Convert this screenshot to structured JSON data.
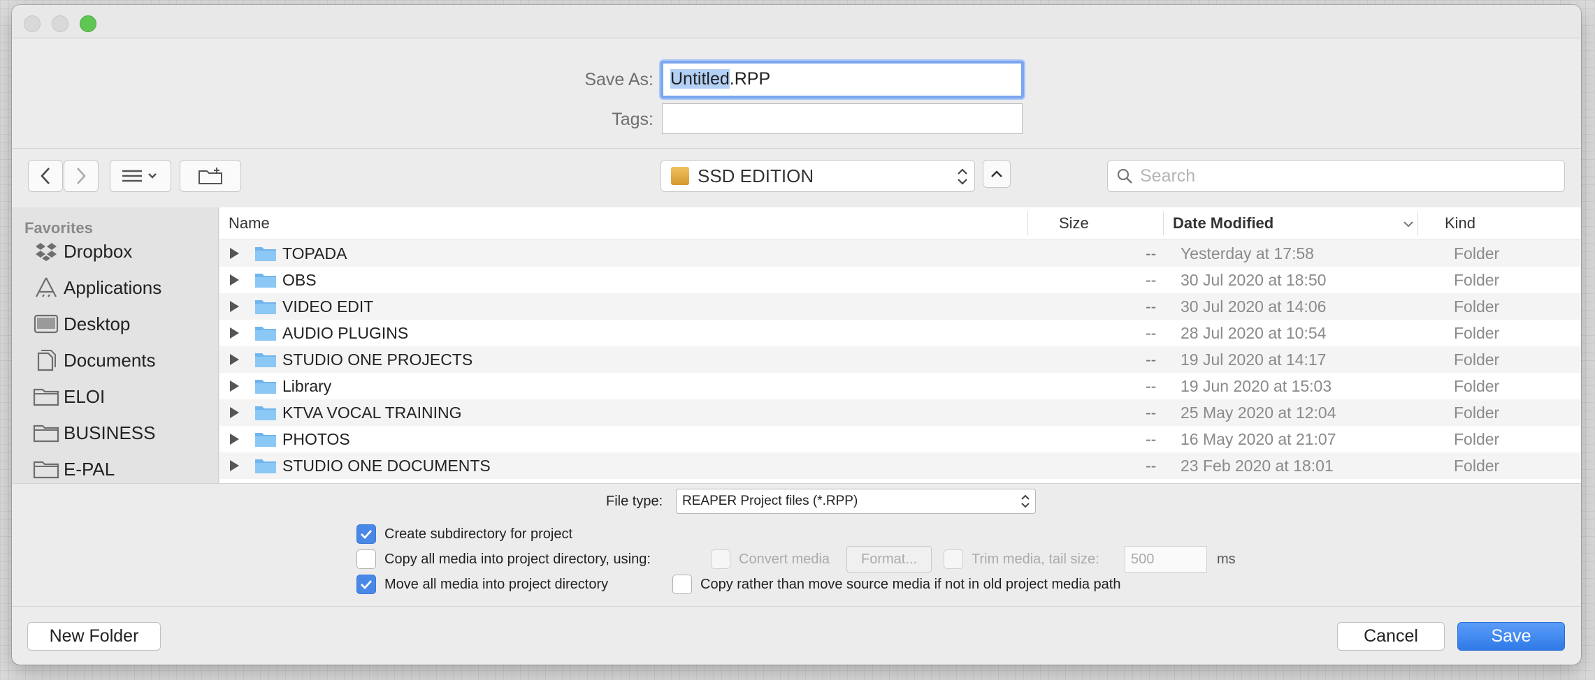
{
  "dialog": {
    "save_as_label": "Save As:",
    "filename_selected": "Untitled",
    "filename_ext": ".RPP",
    "tags_label": "Tags:",
    "tags_value": ""
  },
  "toolbar": {
    "location": "SSD EDITION",
    "search_placeholder": "Search"
  },
  "sidebar": {
    "heading": "Favorites",
    "items": [
      {
        "label": "Dropbox",
        "icon": "dropbox-icon"
      },
      {
        "label": "Applications",
        "icon": "applications-icon"
      },
      {
        "label": "Desktop",
        "icon": "desktop-icon"
      },
      {
        "label": "Documents",
        "icon": "documents-icon"
      },
      {
        "label": "ELOI",
        "icon": "folder-icon"
      },
      {
        "label": "BUSINESS",
        "icon": "folder-icon"
      },
      {
        "label": "E-PAL",
        "icon": "folder-icon"
      }
    ]
  },
  "list": {
    "columns": {
      "name": "Name",
      "size": "Size",
      "date": "Date Modified",
      "kind": "Kind"
    },
    "rows": [
      {
        "name": "TOPADA",
        "size": "--",
        "date": "Yesterday at 17:58",
        "kind": "Folder"
      },
      {
        "name": "OBS",
        "size": "--",
        "date": "30 Jul 2020 at 18:50",
        "kind": "Folder"
      },
      {
        "name": "VIDEO EDIT",
        "size": "--",
        "date": "30 Jul 2020 at 14:06",
        "kind": "Folder"
      },
      {
        "name": "AUDIO PLUGINS",
        "size": "--",
        "date": "28 Jul 2020 at 10:54",
        "kind": "Folder"
      },
      {
        "name": "STUDIO ONE PROJECTS",
        "size": "--",
        "date": "19 Jul 2020 at 14:17",
        "kind": "Folder"
      },
      {
        "name": "Library",
        "size": "--",
        "date": "19 Jun 2020 at 15:03",
        "kind": "Folder"
      },
      {
        "name": "KTVA VOCAL TRAINING",
        "size": "--",
        "date": "25 May 2020 at 12:04",
        "kind": "Folder"
      },
      {
        "name": "PHOTOS",
        "size": "--",
        "date": "16 May 2020 at 21:07",
        "kind": "Folder"
      },
      {
        "name": "STUDIO ONE DOCUMENTS",
        "size": "--",
        "date": "23 Feb 2020 at 18:01",
        "kind": "Folder"
      }
    ]
  },
  "options": {
    "file_type_label": "File type:",
    "file_type_value": "REAPER Project files (*.RPP)",
    "create_subdir": {
      "label": "Create subdirectory for project",
      "checked": true
    },
    "copy_media": {
      "label": "Copy all media into project directory, using:",
      "checked": false
    },
    "convert_media": {
      "label": "Convert media",
      "checked": false
    },
    "format_button": "Format...",
    "trim_media": {
      "label": "Trim media, tail size:",
      "checked": false
    },
    "tail_size": "500",
    "tail_unit": "ms",
    "move_media": {
      "label": "Move all media into project directory",
      "checked": true
    },
    "copy_rather": {
      "label": "Copy rather than move source media if not in old project media path",
      "checked": false
    }
  },
  "footer": {
    "new_folder": "New Folder",
    "cancel": "Cancel",
    "save": "Save"
  },
  "colors": {
    "accent": "#3a82f0",
    "zoom_button": "#5fc553"
  }
}
